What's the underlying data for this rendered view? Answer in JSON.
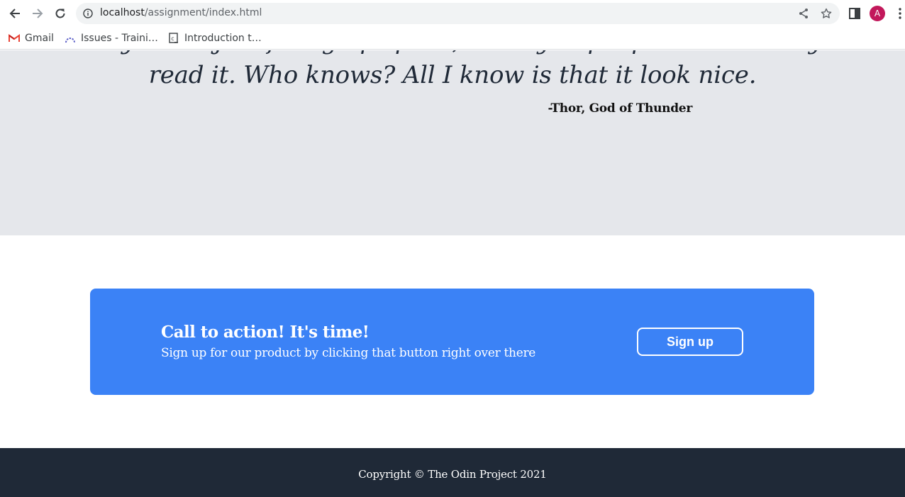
{
  "browser": {
    "url_host": "localhost",
    "url_path": "/assignment/index.html",
    "profile_initial": "A",
    "bookmarks": [
      {
        "label": "Gmail",
        "icon": "gmail-icon"
      },
      {
        "label": "Issues - Traini…",
        "icon": "issues-icon"
      },
      {
        "label": "Introduction t…",
        "icon": "document-icon"
      }
    ]
  },
  "quote": {
    "text": "Maybe it's just filling up space, or maybe people will actually read it. Who knows? All I know is that it look nice.",
    "author": "-Thor, God of Thunder"
  },
  "cta": {
    "title": "Call to action! It's time!",
    "subtitle": "Sign up for our product by clicking that button right over there",
    "button_label": "Sign up"
  },
  "footer": {
    "copyright": "Copyright © The Odin Project 2021"
  },
  "colors": {
    "quote_bg": "#e5e7eb",
    "cta_bg": "#3b82f6",
    "footer_bg": "#1f2937",
    "avatar_bg": "#c2185b"
  }
}
